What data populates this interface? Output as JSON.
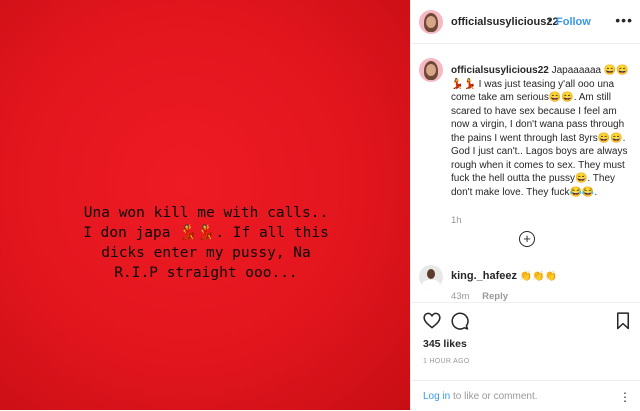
{
  "post_image": {
    "overlay_text": "Una won kill me with calls..\nI don japa 💃💃. If all this\ndicks enter my pussy, Na\nR.I.P straight ooo...",
    "background_color": "#e2151d"
  },
  "header": {
    "username": "officialsusylicious22",
    "separator": "•",
    "follow_label": "Follow",
    "more_icon": "more-horizontal-icon"
  },
  "caption": {
    "username": "officialsusylicious22",
    "text": " Japaaaaaa 😄😄 💃💃 I was just teasing y'all ooo una come take am serious😄😄. Am still scared to have sex because I feel am now a virgin, I don't wana pass through the pains I went through last 8yrs😄😄. God I just can't.. Lagos boys are always rough when it comes to sex. They must fuck the hell outta the pussy😄. They don't make love. They fuck😂😂.",
    "time": "1h"
  },
  "load_more_icon": "plus-circle-icon",
  "reply": {
    "username": "king._hafeez",
    "text": "👏👏👏",
    "time": "43m",
    "reply_label": "Reply"
  },
  "actions": {
    "likes": "345 likes",
    "posted_ago": "1 HOUR AGO"
  },
  "login": {
    "login_link": "Log in",
    "rest": " to like or comment.",
    "more_icon": "more-vertical-icon"
  },
  "colors": {
    "accent": "#3897f0",
    "text": "#262626",
    "muted": "#999999"
  }
}
